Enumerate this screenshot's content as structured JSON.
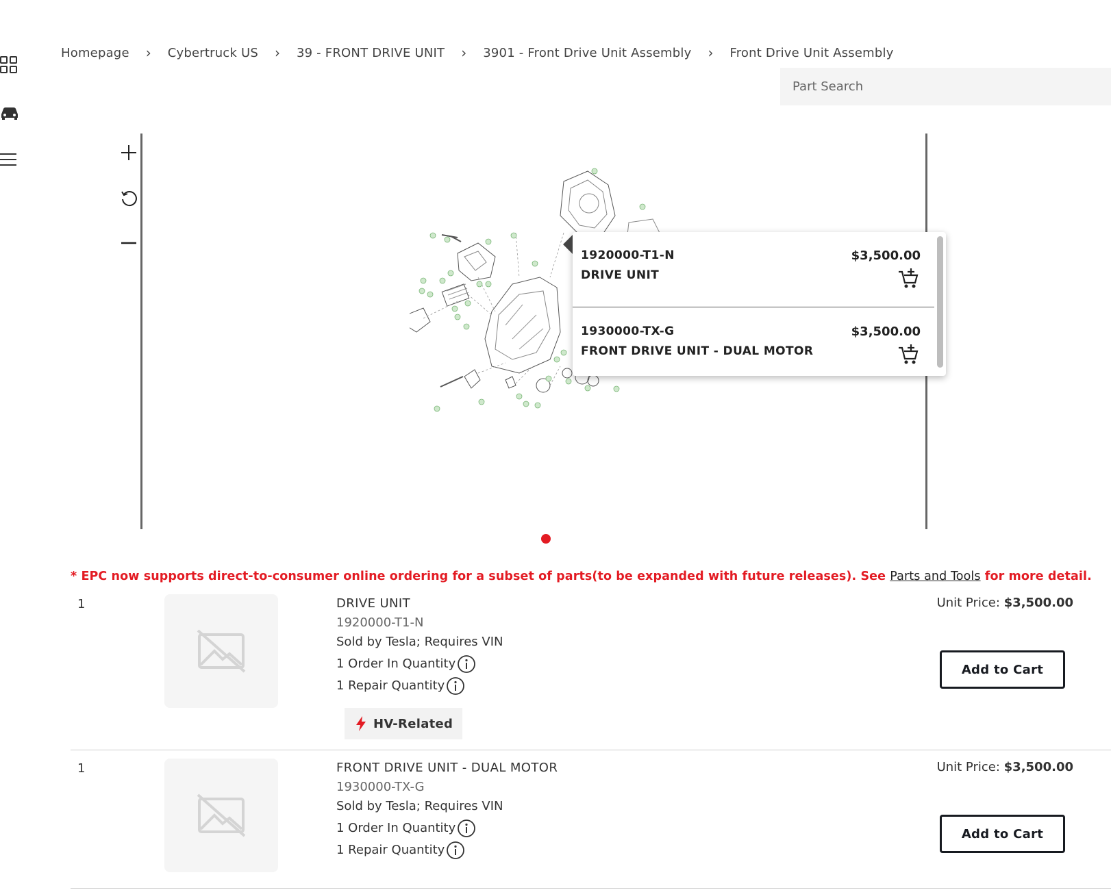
{
  "sidebar": {
    "icons": [
      "grid-icon",
      "car-icon",
      "menu-icon"
    ]
  },
  "breadcrumb": {
    "items": [
      "Homepage",
      "Cybertruck US",
      "39 - FRONT DRIVE UNIT",
      "3901 - Front Drive Unit Assembly",
      "Front Drive Unit Assembly"
    ],
    "separator": "›"
  },
  "search": {
    "placeholder": "Part Search"
  },
  "viewer": {
    "zoom_in_icon": "plus-icon",
    "reset_icon": "rotate-icon",
    "zoom_out_icon": "minus-icon",
    "active_page": 1
  },
  "popover": {
    "items": [
      {
        "part_number": "1920000-T1-N",
        "name": "DRIVE UNIT",
        "price": "$3,500.00"
      },
      {
        "part_number": "1930000-TX-G",
        "name": "FRONT DRIVE UNIT - DUAL MOTOR",
        "price": "$3,500.00"
      }
    ]
  },
  "notice": {
    "prefix": "* EPC now supports direct-to-consumer online ordering for a subset of parts(to be expanded with future releases). See ",
    "link": "Parts and Tools",
    "suffix": " for more detail."
  },
  "parts": [
    {
      "index": "1",
      "name": "DRIVE UNIT",
      "part_number": "1920000-T1-N",
      "sold_by": "Sold by Tesla; Requires VIN",
      "order_qty": "1 Order In Quantity",
      "repair_qty": "1 Repair Quantity",
      "badge": "HV-Related",
      "unit_price_label": "Unit Price:",
      "unit_price": "$3,500.00",
      "button": "Add to Cart"
    },
    {
      "index": "1",
      "name": "FRONT DRIVE UNIT - DUAL MOTOR",
      "part_number": "1930000-TX-G",
      "sold_by": "Sold by Tesla; Requires VIN",
      "order_qty": "1 Order In Quantity",
      "repair_qty": "1 Repair Quantity",
      "unit_price_label": "Unit Price:",
      "unit_price": "$3,500.00",
      "button": "Add to Cart"
    }
  ],
  "colors": {
    "accent_red": "#e31b23",
    "text_dark": "#171a20",
    "callout_green": "#8bc48a"
  }
}
